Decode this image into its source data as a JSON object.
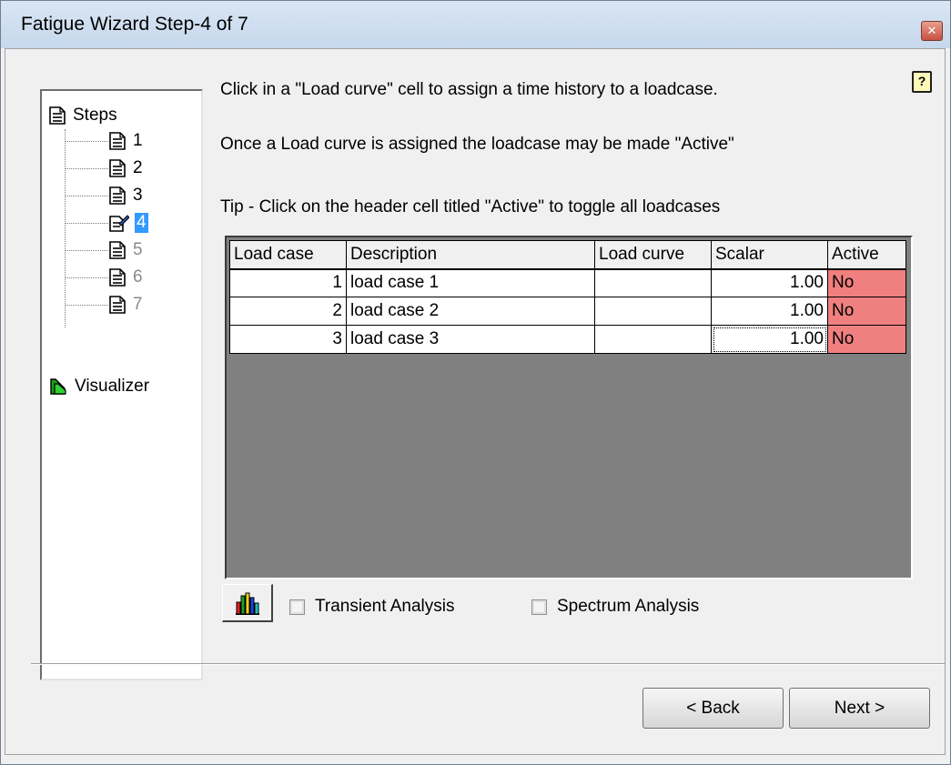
{
  "window": {
    "title": "Fatigue Wizard Step-4 of 7"
  },
  "tree": {
    "root_label": "Steps",
    "steps": [
      {
        "label": "1",
        "state": "normal"
      },
      {
        "label": "2",
        "state": "normal"
      },
      {
        "label": "3",
        "state": "normal"
      },
      {
        "label": "4",
        "state": "selected"
      },
      {
        "label": "5",
        "state": "disabled"
      },
      {
        "label": "6",
        "state": "disabled"
      },
      {
        "label": "7",
        "state": "disabled"
      }
    ],
    "visualizer_label": "Visualizer"
  },
  "instructions": {
    "line1": "Click in a \"Load curve\" cell to assign a time history to a loadcase.",
    "line2": "Once a Load curve is assigned the loadcase  may be made \"Active\"",
    "tip": "Tip - Click on the header cell titled \"Active\" to toggle all loadcases"
  },
  "table": {
    "headers": [
      "Load case",
      "Description",
      "Load curve",
      "Scalar",
      "Active"
    ],
    "rows": [
      {
        "load_case": "1",
        "description": "load case 1",
        "load_curve": "",
        "scalar": "1.00",
        "active": "No"
      },
      {
        "load_case": "2",
        "description": "load case 2",
        "load_curve": "",
        "scalar": "1.00",
        "active": "No"
      },
      {
        "load_case": "3",
        "description": "load case 3",
        "load_curve": "",
        "scalar": "1.00",
        "active": "No"
      }
    ]
  },
  "options": {
    "transient_label": "Transient Analysis",
    "transient_checked": false,
    "spectrum_label": "Spectrum Analysis",
    "spectrum_checked": false
  },
  "buttons": {
    "back_label": "< Back",
    "next_label": "Next >"
  },
  "colors": {
    "active_no": "#f08080",
    "grid_background": "#808080",
    "tree_selection": "#3399ff"
  }
}
